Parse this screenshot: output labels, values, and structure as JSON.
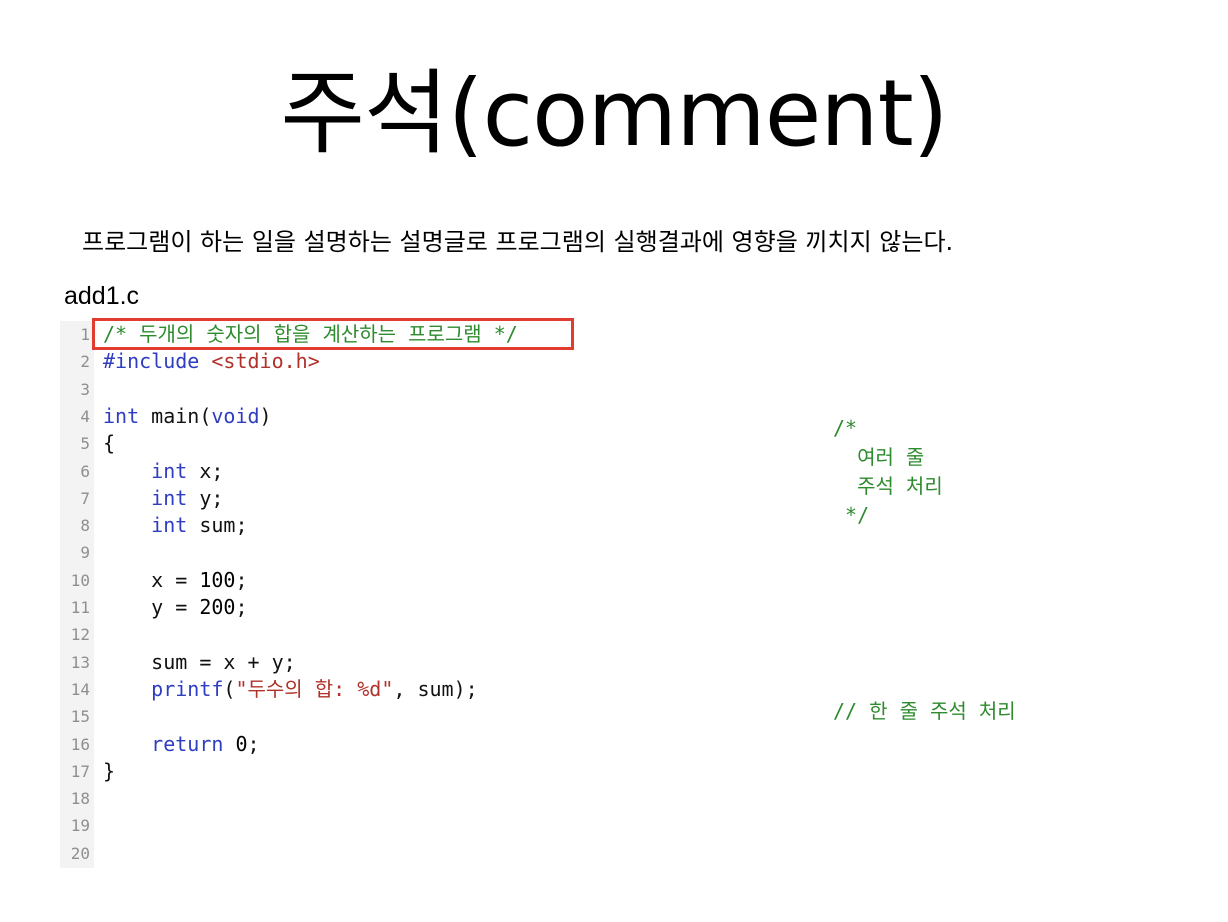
{
  "title": "주석(comment)",
  "subtitle": "프로그램이 하는 일을 설명하는 설명글로 프로그램의 실행결과에 영향을 끼치지 않는다.",
  "filename": "add1.c",
  "code_lines": [
    {
      "num": "1",
      "segments": [
        {
          "cls": "cm",
          "text": "/* 두개의 숫자의 합을 계산하는 프로그램 */"
        }
      ]
    },
    {
      "num": "2",
      "segments": [
        {
          "cls": "pp",
          "text": "#include "
        },
        {
          "cls": "str",
          "text": "<stdio.h>"
        }
      ]
    },
    {
      "num": "3",
      "segments": []
    },
    {
      "num": "4",
      "segments": [
        {
          "cls": "kw",
          "text": "int"
        },
        {
          "cls": "",
          "text": " main("
        },
        {
          "cls": "kw",
          "text": "void"
        },
        {
          "cls": "",
          "text": ")"
        }
      ]
    },
    {
      "num": "5",
      "segments": [
        {
          "cls": "",
          "text": "{"
        }
      ]
    },
    {
      "num": "6",
      "segments": [
        {
          "cls": "",
          "text": "    "
        },
        {
          "cls": "kw",
          "text": "int"
        },
        {
          "cls": "",
          "text": " x;"
        }
      ]
    },
    {
      "num": "7",
      "segments": [
        {
          "cls": "",
          "text": "    "
        },
        {
          "cls": "kw",
          "text": "int"
        },
        {
          "cls": "",
          "text": " y;"
        }
      ]
    },
    {
      "num": "8",
      "segments": [
        {
          "cls": "",
          "text": "    "
        },
        {
          "cls": "kw",
          "text": "int"
        },
        {
          "cls": "",
          "text": " sum;"
        }
      ]
    },
    {
      "num": "9",
      "segments": []
    },
    {
      "num": "10",
      "segments": [
        {
          "cls": "",
          "text": "    x = "
        },
        {
          "cls": "num",
          "text": "100"
        },
        {
          "cls": "",
          "text": ";"
        }
      ]
    },
    {
      "num": "11",
      "segments": [
        {
          "cls": "",
          "text": "    y = "
        },
        {
          "cls": "num",
          "text": "200"
        },
        {
          "cls": "",
          "text": ";"
        }
      ]
    },
    {
      "num": "12",
      "segments": []
    },
    {
      "num": "13",
      "segments": [
        {
          "cls": "",
          "text": "    sum = x + y;"
        }
      ]
    },
    {
      "num": "14",
      "segments": [
        {
          "cls": "",
          "text": "    "
        },
        {
          "cls": "kw",
          "text": "printf"
        },
        {
          "cls": "",
          "text": "("
        },
        {
          "cls": "str",
          "text": "\"두수의 합: %d\""
        },
        {
          "cls": "",
          "text": ", sum);"
        }
      ]
    },
    {
      "num": "15",
      "segments": []
    },
    {
      "num": "16",
      "segments": [
        {
          "cls": "",
          "text": "    "
        },
        {
          "cls": "kw",
          "text": "return"
        },
        {
          "cls": "",
          "text": " "
        },
        {
          "cls": "num",
          "text": "0"
        },
        {
          "cls": "",
          "text": ";"
        }
      ]
    },
    {
      "num": "17",
      "segments": [
        {
          "cls": "",
          "text": "}"
        }
      ]
    },
    {
      "num": "18",
      "segments": []
    },
    {
      "num": "19",
      "segments": []
    },
    {
      "num": "20",
      "segments": []
    }
  ],
  "multiline_comment": "/*\n  여러 줄\n  주석 처리\n */",
  "single_line_comment": "// 한 줄 주석 처리",
  "colors": {
    "keyword": "#2f3dc0",
    "string": "#b0322a",
    "comment": "#2e8b2e",
    "highlight_border": "#e23b2f"
  }
}
